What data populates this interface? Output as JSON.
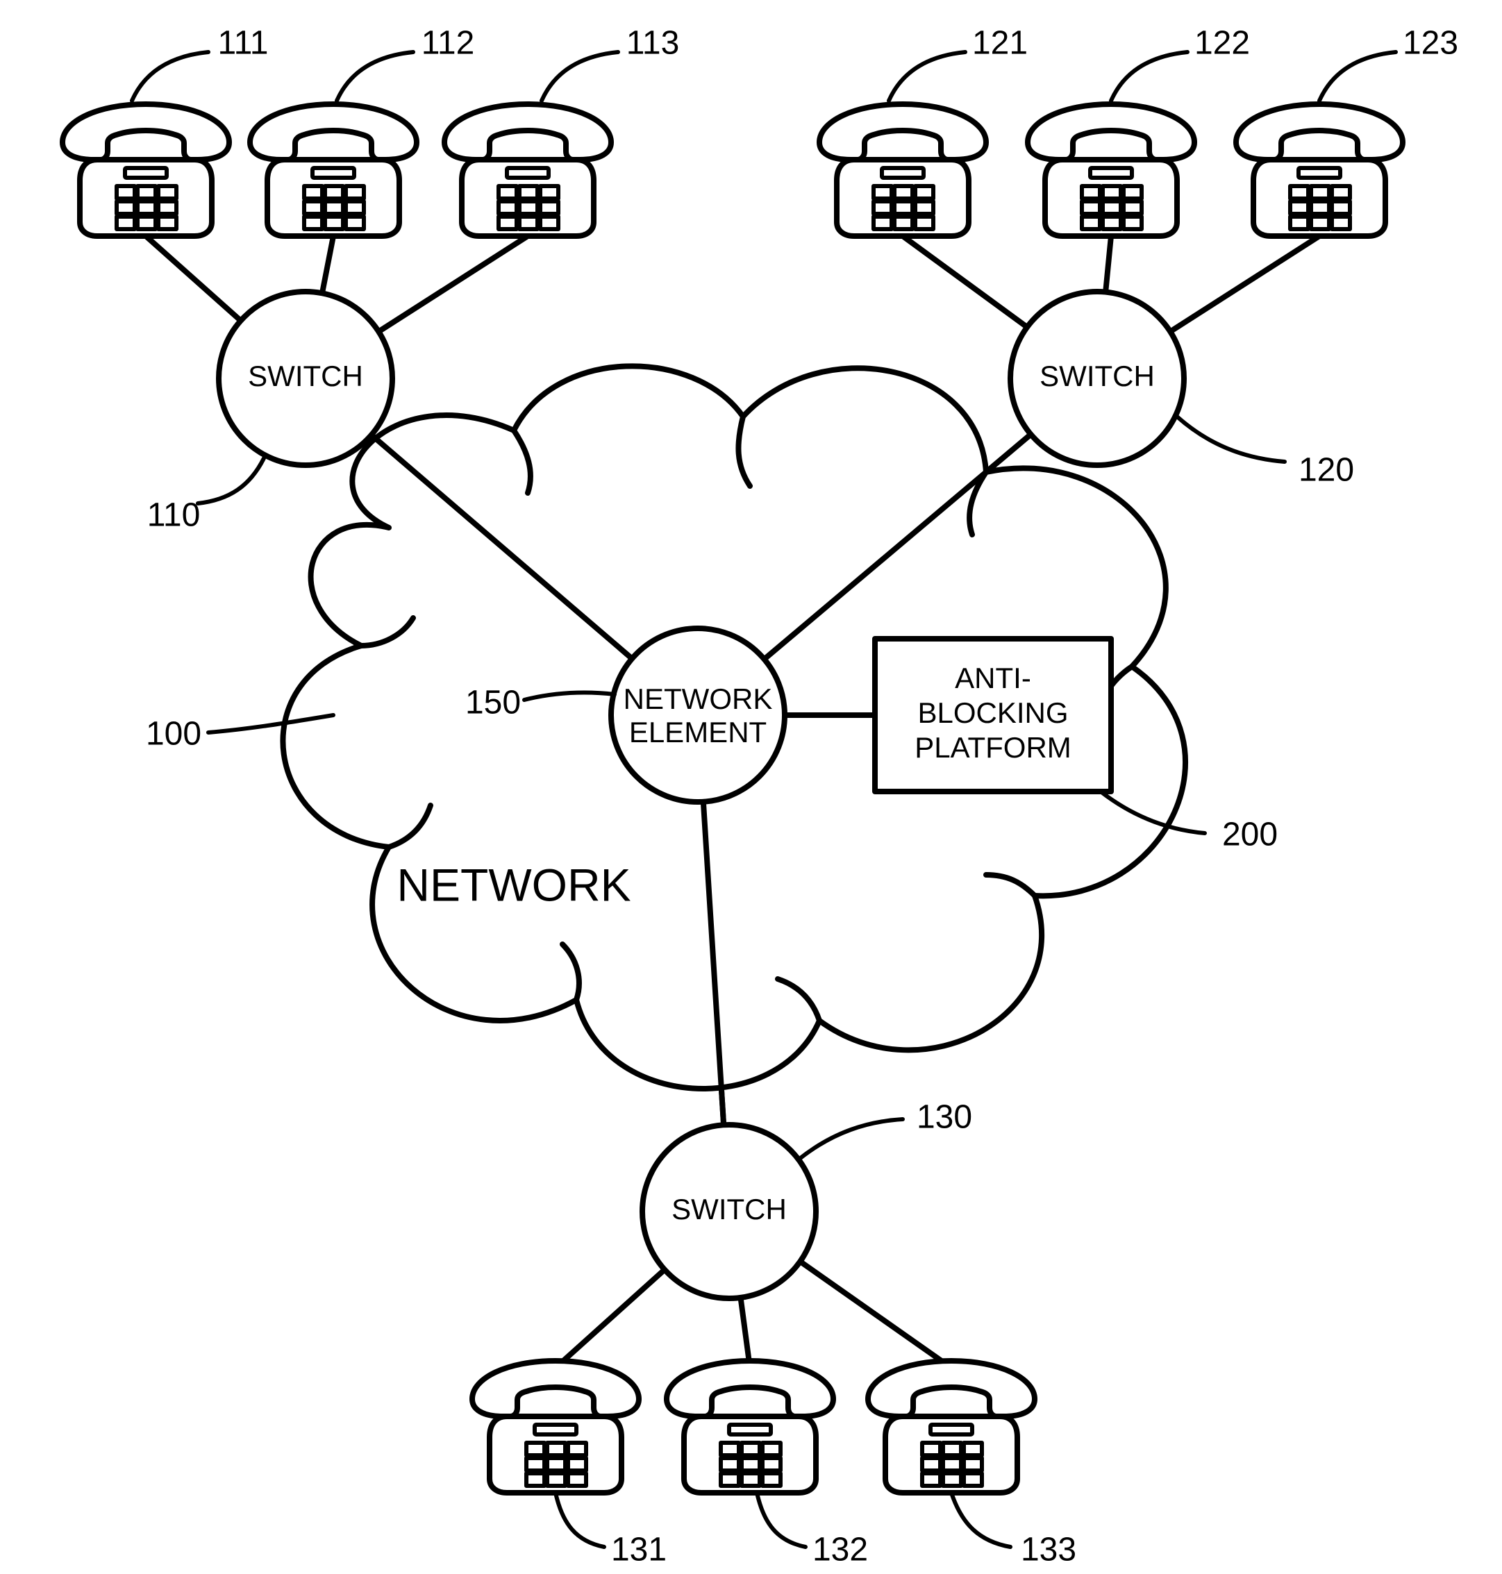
{
  "refs": {
    "r111": "111",
    "r112": "112",
    "r113": "113",
    "r121": "121",
    "r122": "122",
    "r123": "123",
    "r131": "131",
    "r132": "132",
    "r133": "133",
    "r110": "110",
    "r120": "120",
    "r130": "130",
    "r100": "100",
    "r150": "150",
    "r200": "200"
  },
  "nodes": {
    "switch": "SWITCH",
    "network_element_l1": "NETWORK",
    "network_element_l2": "ELEMENT",
    "anti_l1": "ANTI-",
    "anti_l2": "BLOCKING",
    "anti_l3": "PLATFORM",
    "network": "NETWORK"
  },
  "chart_data": {
    "type": "diagram",
    "title": "Telephony network with anti-blocking platform",
    "nodes": [
      {
        "id": "net100",
        "type": "cloud",
        "label": "NETWORK",
        "ref": "100"
      },
      {
        "id": "ne150",
        "type": "circle",
        "label": "NETWORK ELEMENT",
        "ref": "150"
      },
      {
        "id": "abp200",
        "type": "box",
        "label": "ANTI-BLOCKING PLATFORM",
        "ref": "200"
      },
      {
        "id": "sw110",
        "type": "circle",
        "label": "SWITCH",
        "ref": "110"
      },
      {
        "id": "sw120",
        "type": "circle",
        "label": "SWITCH",
        "ref": "120"
      },
      {
        "id": "sw130",
        "type": "circle",
        "label": "SWITCH",
        "ref": "130"
      },
      {
        "id": "ph111",
        "type": "phone",
        "ref": "111"
      },
      {
        "id": "ph112",
        "type": "phone",
        "ref": "112"
      },
      {
        "id": "ph113",
        "type": "phone",
        "ref": "113"
      },
      {
        "id": "ph121",
        "type": "phone",
        "ref": "121"
      },
      {
        "id": "ph122",
        "type": "phone",
        "ref": "122"
      },
      {
        "id": "ph123",
        "type": "phone",
        "ref": "123"
      },
      {
        "id": "ph131",
        "type": "phone",
        "ref": "131"
      },
      {
        "id": "ph132",
        "type": "phone",
        "ref": "132"
      },
      {
        "id": "ph133",
        "type": "phone",
        "ref": "133"
      }
    ],
    "edges": [
      [
        "sw110",
        "ph111"
      ],
      [
        "sw110",
        "ph112"
      ],
      [
        "sw110",
        "ph113"
      ],
      [
        "sw120",
        "ph121"
      ],
      [
        "sw120",
        "ph122"
      ],
      [
        "sw120",
        "ph123"
      ],
      [
        "sw130",
        "ph131"
      ],
      [
        "sw130",
        "ph132"
      ],
      [
        "sw130",
        "ph133"
      ],
      [
        "ne150",
        "sw110"
      ],
      [
        "ne150",
        "sw120"
      ],
      [
        "ne150",
        "sw130"
      ],
      [
        "ne150",
        "abp200"
      ]
    ]
  }
}
